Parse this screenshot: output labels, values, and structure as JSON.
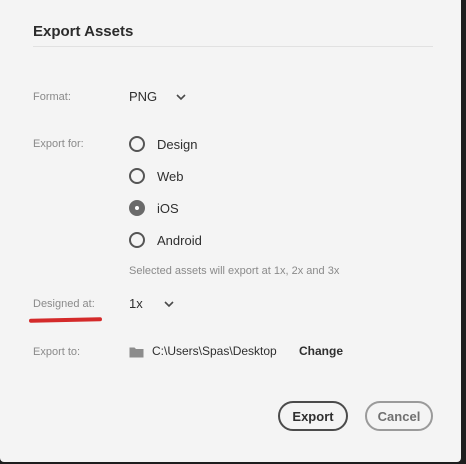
{
  "dialog": {
    "title": "Export Assets",
    "format": {
      "label": "Format:",
      "selected": "PNG"
    },
    "export_for": {
      "label": "Export for:",
      "options": [
        {
          "label": "Design",
          "checked": false
        },
        {
          "label": "Web",
          "checked": false
        },
        {
          "label": "iOS",
          "checked": true
        },
        {
          "label": "Android",
          "checked": false
        }
      ],
      "hint": "Selected assets will export at 1x, 2x and 3x"
    },
    "designed_at": {
      "label": "Designed at:",
      "selected": "1x"
    },
    "export_to": {
      "label": "Export to:",
      "path": "C:\\Users\\Spas\\Desktop",
      "change_label": "Change"
    },
    "buttons": {
      "export_label": "Export",
      "cancel_label": "Cancel"
    }
  },
  "colors": {
    "dialog_bg": "#f4f4f4",
    "annotation_red": "#d42a2a",
    "icon_gray": "#8c8c8c"
  }
}
